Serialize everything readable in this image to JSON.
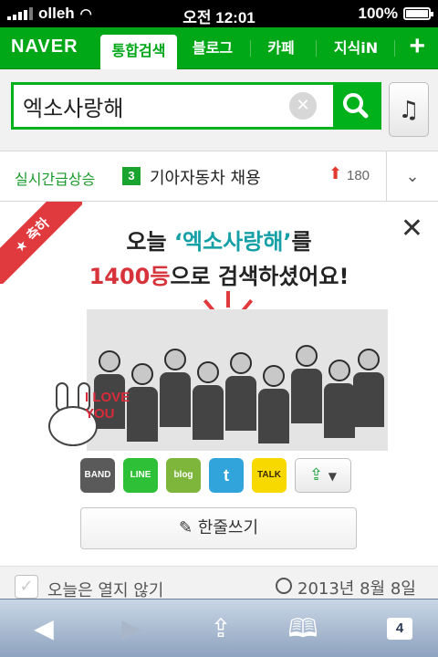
{
  "status_bar": {
    "carrier": "olleh",
    "time": "오전 12:01",
    "battery": "100%"
  },
  "header": {
    "logo": "NAVER",
    "tabs": [
      {
        "label": "통합검색",
        "active": true
      },
      {
        "label": "블로그",
        "active": false
      },
      {
        "label": "카페",
        "active": false
      },
      {
        "label": "지식iN",
        "active": false
      }
    ],
    "add_icon": "plus-icon",
    "brand_color": "#00a717"
  },
  "search": {
    "query": "엑소사랑해",
    "clear_icon": "clear-icon",
    "search_icon": "search-icon",
    "music_icon": "music-note-icon"
  },
  "realtime": {
    "label": "실시간급상승",
    "rank": "3",
    "keyword": "기아자동차 채용",
    "change": "180",
    "toggle_icon": "chevron-down-icon"
  },
  "celebration": {
    "badge": "축하",
    "headline1_prefix": "오늘",
    "headline1_keyword": "‘엑소사랑해’",
    "headline1_suffix": "를",
    "headline2_count": "1400등",
    "headline2_suffix": "으로 검색하셨어요!",
    "love_text": "I LOVE YOU",
    "share": [
      {
        "name": "band",
        "label": "BAND",
        "color": "#5a5a5a"
      },
      {
        "name": "line",
        "label": "LINE",
        "color": "#2ec036"
      },
      {
        "name": "blog",
        "label": "blog",
        "color": "#7db63a"
      },
      {
        "name": "twitter",
        "label": "t",
        "color": "#32a4dc"
      },
      {
        "name": "kakaotalk",
        "label": "TALK",
        "color": "#f7d900"
      }
    ],
    "write_label": "한줄쓰기"
  },
  "footer": {
    "dont_open_label": "오늘은 열지 않기",
    "date": "2013년 8월 8일"
  },
  "toolbar": {
    "tab_count": "4"
  }
}
